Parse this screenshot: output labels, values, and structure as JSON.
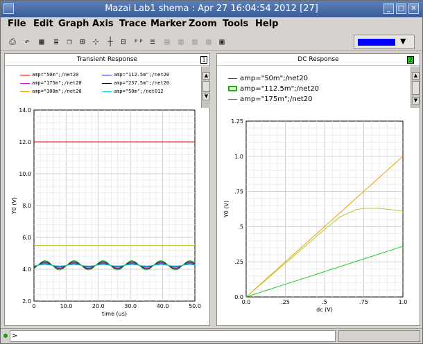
{
  "window": {
    "title": "Mazai Lab1 shema : Apr 27 16:04:54 2012 [27]",
    "buttons": {
      "minimize": "_",
      "maximize": "□",
      "close": "✕"
    }
  },
  "menu": [
    "File",
    "Edit",
    "Graph",
    "Axis",
    "Trace",
    "Marker",
    "Zoom",
    "Tools",
    "Help"
  ],
  "toolbar": {
    "icons": [
      "printer-icon",
      "undo-icon",
      "grid-icon",
      "strip-icon",
      "window-icon",
      "crosshair-icon",
      "marker-icon",
      "text-marker-icon",
      "table-icon",
      "zoom-icon",
      "disabled-icon",
      "calculator-icon"
    ],
    "trace_color": "#0000ff",
    "dropdown_arrow": "▼"
  },
  "left_panel": {
    "title": "Transient Response",
    "number": "1",
    "legend": [
      {
        "label": "amp=\"50m\";/net20",
        "color": "#e00000"
      },
      {
        "label": "amp=\"112.5m\";/net20",
        "color": "#1c1cbe"
      },
      {
        "label": "amp=\"175m\";/net20",
        "color": "#e000e0"
      },
      {
        "label": "amp=\"237.5m\";/net20",
        "color": "#000000"
      },
      {
        "label": "amp=\"300m\";/net20",
        "color": "#f0a000"
      },
      {
        "label": "amp=\"50m\";/net012",
        "color": "#00d8d8"
      }
    ]
  },
  "right_panel": {
    "title": "DC Response",
    "number": "2",
    "legend": [
      {
        "label": "amp=\"50m\";/net20",
        "color": "#e00000"
      },
      {
        "label": "amp=\"112.5m\";/net20",
        "color": "#00c000"
      },
      {
        "label": "amp=\"175m\";/net20",
        "color": "#e000e0"
      }
    ]
  },
  "chart_data": [
    {
      "type": "line",
      "title": "Transient Response",
      "xlabel": "time (us)",
      "ylabel": "Y0 (V)",
      "xlim": [
        0,
        50
      ],
      "ylim": [
        2,
        14
      ],
      "xticks": [
        "0",
        "10.0",
        "20.0",
        "30.0",
        "40.0",
        "50.0"
      ],
      "yticks": [
        "2.0",
        "4.0",
        "6.0",
        "8.0",
        "10.0",
        "12.0",
        "14.0"
      ],
      "grid": true,
      "series": [
        {
          "name": "amp=\"50m\";/net20",
          "color": "#e00000",
          "kind": "const",
          "value": 12.0
        },
        {
          "name": "amp=\"300m\";/net20",
          "color": "#a8d030",
          "kind": "const",
          "value": 5.5
        },
        {
          "name": "amp=\"50m\";/net20",
          "color": "#e00000",
          "kind": "sine",
          "offset": 4.25,
          "amp": 0.05,
          "period": 9.0
        },
        {
          "name": "amp=\"112.5m\";/net20",
          "color": "#1c1cbe",
          "kind": "sine",
          "offset": 4.25,
          "amp": 0.11,
          "period": 9.0
        },
        {
          "name": "amp=\"175m\";/net20",
          "color": "#e000e0",
          "kind": "sine",
          "offset": 4.25,
          "amp": 0.17,
          "period": 9.0
        },
        {
          "name": "amp=\"237.5m\";/net20",
          "color": "#000000",
          "kind": "sine",
          "offset": 4.25,
          "amp": 0.23,
          "period": 9.0
        },
        {
          "name": "amp=\"300m\";/net20",
          "color": "#22cc22",
          "kind": "sine",
          "offset": 4.25,
          "amp": 0.29,
          "period": 9.0
        },
        {
          "name": "amp=\"50m\";/net012",
          "color": "#00d8d8",
          "kind": "sine",
          "offset": 4.25,
          "amp": 0.05,
          "period": 9.0
        }
      ]
    },
    {
      "type": "line",
      "title": "DC Response",
      "xlabel": "dc (V)",
      "ylabel": "Y0 (V)",
      "xlim": [
        0,
        1.0
      ],
      "ylim": [
        0,
        1.25
      ],
      "xticks": [
        "0.0",
        ".25",
        ".5",
        ".75",
        "1.0"
      ],
      "yticks": [
        "0.0",
        ".25",
        ".5",
        ".75",
        "1.0",
        "1.25"
      ],
      "grid": true,
      "series": [
        {
          "name": "orange",
          "color": "#f0a000",
          "x": [
            0,
            0.25,
            0.5,
            0.75,
            1.0
          ],
          "y": [
            0,
            0.25,
            0.5,
            0.75,
            1.0
          ]
        },
        {
          "name": "yellow-green",
          "color": "#a8d030",
          "x": [
            0,
            0.25,
            0.5,
            0.6,
            0.7,
            0.75,
            0.85,
            1.0
          ],
          "y": [
            0,
            0.24,
            0.48,
            0.57,
            0.62,
            0.63,
            0.63,
            0.61
          ]
        },
        {
          "name": "amp=\"112.5m\";/net20",
          "color": "#22cc22",
          "x": [
            0,
            0.25,
            0.5,
            0.75,
            1.0
          ],
          "y": [
            0,
            0.09,
            0.18,
            0.27,
            0.36
          ]
        }
      ]
    }
  ],
  "status": {
    "prompt": ">"
  }
}
